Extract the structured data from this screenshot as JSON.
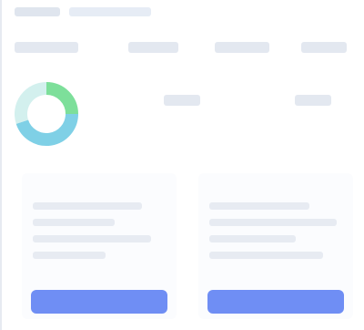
{
  "header": {
    "title": "",
    "crumbs": [
      "",
      ""
    ]
  },
  "table": {
    "columns": [
      "",
      "",
      "",
      ""
    ]
  },
  "donut": {
    "segments": [
      {
        "color": "#7ddf9a",
        "fraction": 0.25
      },
      {
        "color": "#7fd0e6",
        "fraction": 0.45
      },
      {
        "color": "#d3f0ee",
        "fraction": 0.3
      }
    ]
  },
  "metrics": [
    "",
    ""
  ],
  "cards": [
    {
      "title": "",
      "button_label": ""
    },
    {
      "title": "",
      "button_label": ""
    }
  ],
  "colors": {
    "accent": "#6f8ef4",
    "muted": "#e3e8f0"
  }
}
